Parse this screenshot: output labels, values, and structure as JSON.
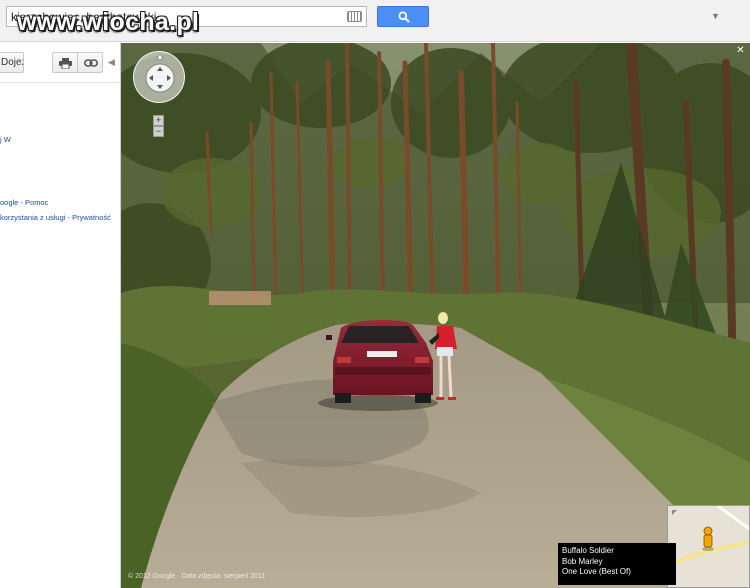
{
  "watermark": "www.wiocha.pl",
  "search": {
    "value": "kierzchowiec, berchatowski"
  },
  "panel": {
    "directions_label": "Dojeżdżaj",
    "text_1": "j W",
    "text_2": "oogle - Pomoc",
    "text_3": "korzystania z usługi - Prywatność"
  },
  "streetview": {
    "zoom_in": "+",
    "zoom_out": "−",
    "close": "✕",
    "music": {
      "line1": "Buffalo Soldier",
      "line2": "Bob Marley",
      "line3": "One Love (Best Of)"
    },
    "copyright": "© 2012 Google · Data zdjęcia: sierpień 2011"
  },
  "icons": [
    "search-icon",
    "keyboard-icon",
    "print-icon",
    "link-icon",
    "pegman-icon",
    "close-icon",
    "navigation-control-icon"
  ]
}
